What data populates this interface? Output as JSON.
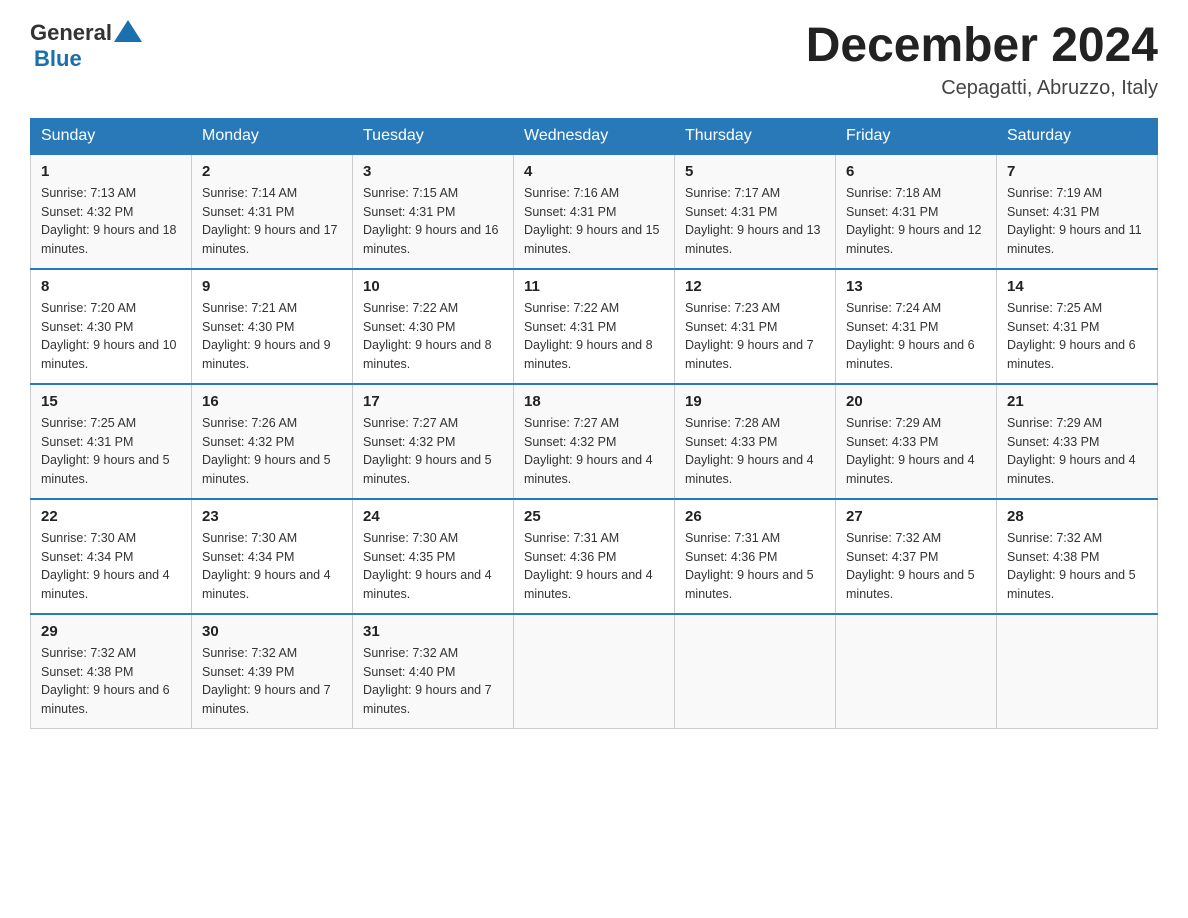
{
  "header": {
    "logo_general": "General",
    "logo_blue": "Blue",
    "title": "December 2024",
    "subtitle": "Cepagatti, Abruzzo, Italy"
  },
  "days_of_week": [
    "Sunday",
    "Monday",
    "Tuesday",
    "Wednesday",
    "Thursday",
    "Friday",
    "Saturday"
  ],
  "weeks": [
    [
      {
        "day": "1",
        "sunrise": "7:13 AM",
        "sunset": "4:32 PM",
        "daylight": "9 hours and 18 minutes."
      },
      {
        "day": "2",
        "sunrise": "7:14 AM",
        "sunset": "4:31 PM",
        "daylight": "9 hours and 17 minutes."
      },
      {
        "day": "3",
        "sunrise": "7:15 AM",
        "sunset": "4:31 PM",
        "daylight": "9 hours and 16 minutes."
      },
      {
        "day": "4",
        "sunrise": "7:16 AM",
        "sunset": "4:31 PM",
        "daylight": "9 hours and 15 minutes."
      },
      {
        "day": "5",
        "sunrise": "7:17 AM",
        "sunset": "4:31 PM",
        "daylight": "9 hours and 13 minutes."
      },
      {
        "day": "6",
        "sunrise": "7:18 AM",
        "sunset": "4:31 PM",
        "daylight": "9 hours and 12 minutes."
      },
      {
        "day": "7",
        "sunrise": "7:19 AM",
        "sunset": "4:31 PM",
        "daylight": "9 hours and 11 minutes."
      }
    ],
    [
      {
        "day": "8",
        "sunrise": "7:20 AM",
        "sunset": "4:30 PM",
        "daylight": "9 hours and 10 minutes."
      },
      {
        "day": "9",
        "sunrise": "7:21 AM",
        "sunset": "4:30 PM",
        "daylight": "9 hours and 9 minutes."
      },
      {
        "day": "10",
        "sunrise": "7:22 AM",
        "sunset": "4:30 PM",
        "daylight": "9 hours and 8 minutes."
      },
      {
        "day": "11",
        "sunrise": "7:22 AM",
        "sunset": "4:31 PM",
        "daylight": "9 hours and 8 minutes."
      },
      {
        "day": "12",
        "sunrise": "7:23 AM",
        "sunset": "4:31 PM",
        "daylight": "9 hours and 7 minutes."
      },
      {
        "day": "13",
        "sunrise": "7:24 AM",
        "sunset": "4:31 PM",
        "daylight": "9 hours and 6 minutes."
      },
      {
        "day": "14",
        "sunrise": "7:25 AM",
        "sunset": "4:31 PM",
        "daylight": "9 hours and 6 minutes."
      }
    ],
    [
      {
        "day": "15",
        "sunrise": "7:25 AM",
        "sunset": "4:31 PM",
        "daylight": "9 hours and 5 minutes."
      },
      {
        "day": "16",
        "sunrise": "7:26 AM",
        "sunset": "4:32 PM",
        "daylight": "9 hours and 5 minutes."
      },
      {
        "day": "17",
        "sunrise": "7:27 AM",
        "sunset": "4:32 PM",
        "daylight": "9 hours and 5 minutes."
      },
      {
        "day": "18",
        "sunrise": "7:27 AM",
        "sunset": "4:32 PM",
        "daylight": "9 hours and 4 minutes."
      },
      {
        "day": "19",
        "sunrise": "7:28 AM",
        "sunset": "4:33 PM",
        "daylight": "9 hours and 4 minutes."
      },
      {
        "day": "20",
        "sunrise": "7:29 AM",
        "sunset": "4:33 PM",
        "daylight": "9 hours and 4 minutes."
      },
      {
        "day": "21",
        "sunrise": "7:29 AM",
        "sunset": "4:33 PM",
        "daylight": "9 hours and 4 minutes."
      }
    ],
    [
      {
        "day": "22",
        "sunrise": "7:30 AM",
        "sunset": "4:34 PM",
        "daylight": "9 hours and 4 minutes."
      },
      {
        "day": "23",
        "sunrise": "7:30 AM",
        "sunset": "4:34 PM",
        "daylight": "9 hours and 4 minutes."
      },
      {
        "day": "24",
        "sunrise": "7:30 AM",
        "sunset": "4:35 PM",
        "daylight": "9 hours and 4 minutes."
      },
      {
        "day": "25",
        "sunrise": "7:31 AM",
        "sunset": "4:36 PM",
        "daylight": "9 hours and 4 minutes."
      },
      {
        "day": "26",
        "sunrise": "7:31 AM",
        "sunset": "4:36 PM",
        "daylight": "9 hours and 5 minutes."
      },
      {
        "day": "27",
        "sunrise": "7:32 AM",
        "sunset": "4:37 PM",
        "daylight": "9 hours and 5 minutes."
      },
      {
        "day": "28",
        "sunrise": "7:32 AM",
        "sunset": "4:38 PM",
        "daylight": "9 hours and 5 minutes."
      }
    ],
    [
      {
        "day": "29",
        "sunrise": "7:32 AM",
        "sunset": "4:38 PM",
        "daylight": "9 hours and 6 minutes."
      },
      {
        "day": "30",
        "sunrise": "7:32 AM",
        "sunset": "4:39 PM",
        "daylight": "9 hours and 7 minutes."
      },
      {
        "day": "31",
        "sunrise": "7:32 AM",
        "sunset": "4:40 PM",
        "daylight": "9 hours and 7 minutes."
      },
      null,
      null,
      null,
      null
    ]
  ]
}
